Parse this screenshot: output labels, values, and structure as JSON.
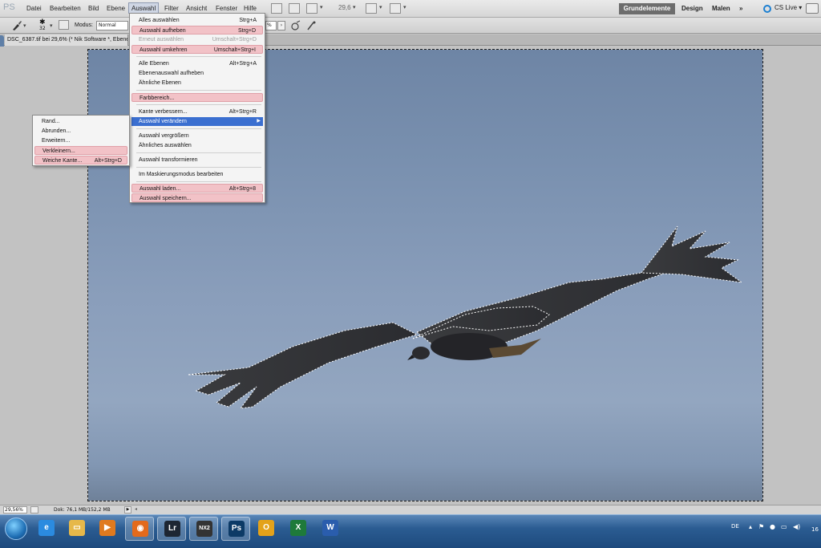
{
  "app": {
    "logo": "PS",
    "menus": [
      "Datei",
      "Bearbeiten",
      "Bild",
      "Ebene",
      "Auswahl",
      "Filter",
      "Ansicht",
      "Fenster",
      "Hilfe"
    ],
    "active_menu": "Auswahl",
    "zoom_display": "29,6",
    "workspaces": {
      "active": "Grundelemente",
      "design": "Design",
      "malen": "Malen",
      "more": "»"
    },
    "cs_live": "CS Live ▾"
  },
  "options_bar": {
    "brush_size": "32",
    "modus_label": "Modus:",
    "modus_value": "Normal",
    "percent_value": "%"
  },
  "document": {
    "tab_title": "DSC_6387.tif bei 29,6% (* Nik Software *, Ebene"
  },
  "auswahl_menu": {
    "items": [
      {
        "label": "Alles auswählen",
        "shortcut": "Strg+A",
        "state": "normal"
      },
      {
        "label": "Auswahl aufheben",
        "shortcut": "Strg+D",
        "state": "highlighted"
      },
      {
        "label": "Erneut auswählen",
        "shortcut": "Umschalt+Strg+D",
        "state": "disabled"
      },
      {
        "label": "Auswahl umkehren",
        "shortcut": "Umschalt+Strg+I",
        "state": "highlighted"
      },
      {
        "label": "Alle Ebenen",
        "shortcut": "Alt+Strg+A",
        "state": "normal"
      },
      {
        "label": "Ebenenauswahl aufheben",
        "shortcut": "",
        "state": "normal"
      },
      {
        "label": "Ähnliche Ebenen",
        "shortcut": "",
        "state": "normal"
      },
      {
        "label": "Farbbereich...",
        "shortcut": "",
        "state": "highlighted"
      },
      {
        "label": "Kante verbessern...",
        "shortcut": "Alt+Strg+R",
        "state": "normal"
      },
      {
        "label": "Auswahl verändern",
        "shortcut": "",
        "state": "selected"
      },
      {
        "label": "Auswahl vergrößern",
        "shortcut": "",
        "state": "normal"
      },
      {
        "label": "Ähnliches auswählen",
        "shortcut": "",
        "state": "normal"
      },
      {
        "label": "Auswahl transformieren",
        "shortcut": "",
        "state": "normal"
      },
      {
        "label": "Im Maskierungsmodus bearbeiten",
        "shortcut": "",
        "state": "normal"
      },
      {
        "label": "Auswahl laden...",
        "shortcut": "Alt+Strg+8",
        "state": "highlighted"
      },
      {
        "label": "Auswahl speichern...",
        "shortcut": "",
        "state": "highlighted"
      }
    ]
  },
  "submenu": {
    "items": [
      {
        "label": "Rand...",
        "shortcut": "",
        "state": "normal"
      },
      {
        "label": "Abrunden...",
        "shortcut": "",
        "state": "normal"
      },
      {
        "label": "Erweitern...",
        "shortcut": "",
        "state": "normal"
      },
      {
        "label": "Verkleinern...",
        "shortcut": "",
        "state": "highlighted"
      },
      {
        "label": "Weiche Kante...",
        "shortcut": "Alt+Strg+D",
        "state": "highlighted"
      }
    ]
  },
  "status_bar": {
    "zoom": "29,56%",
    "doc_info": "Dok: 76,1 MB/152,2 MB"
  },
  "taskbar": {
    "apps": [
      {
        "name": "internet-explorer",
        "glyph": "e",
        "color": "#2b8be0"
      },
      {
        "name": "explorer",
        "glyph": "▭",
        "color": "#e6b84a"
      },
      {
        "name": "media-player",
        "glyph": "▶",
        "color": "#e07a1f"
      },
      {
        "name": "firefox",
        "glyph": "◉",
        "color": "#e36a1c"
      },
      {
        "name": "lightroom",
        "glyph": "Lr",
        "color": "#1d2633"
      },
      {
        "name": "nikon-capture-nx2",
        "glyph": "NX2",
        "color": "#333333"
      },
      {
        "name": "photoshop",
        "glyph": "Ps",
        "color": "#0c3a66"
      },
      {
        "name": "outlook",
        "glyph": "O",
        "color": "#e3a21a"
      },
      {
        "name": "excel",
        "glyph": "X",
        "color": "#1e7a3a"
      },
      {
        "name": "word",
        "glyph": "W",
        "color": "#2a5dad"
      }
    ],
    "language": "DE",
    "time": "16"
  }
}
